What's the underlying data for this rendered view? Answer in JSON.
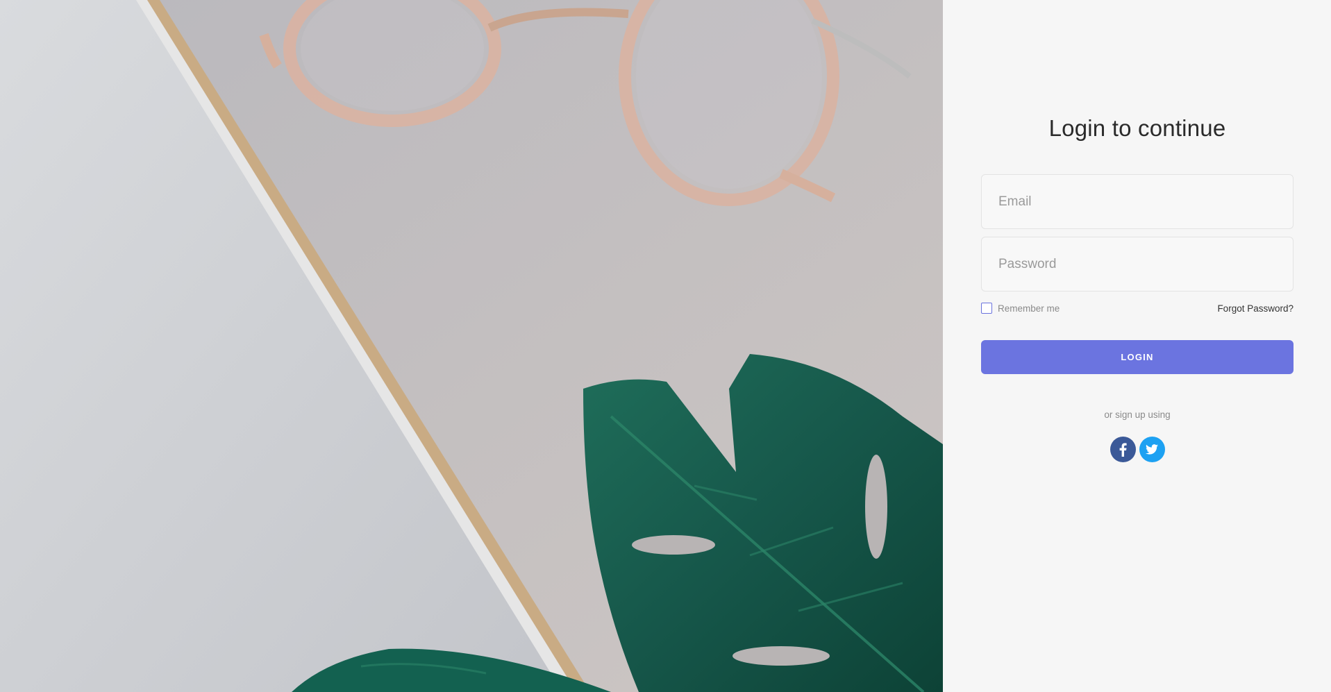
{
  "login": {
    "title": "Login to continue",
    "email_placeholder": "Email",
    "password_placeholder": "Password",
    "remember_label": "Remember me",
    "forgot_label": "Forgot Password?",
    "login_label": "LOGIN",
    "signup_text": "or sign up using"
  },
  "social": [
    {
      "icon": "facebook-icon",
      "color": "#3b5998"
    },
    {
      "icon": "twitter-icon",
      "color": "#1da1f2"
    }
  ],
  "colors": {
    "accent": "#6b74e0",
    "panel_bg": "#f6f6f6"
  }
}
